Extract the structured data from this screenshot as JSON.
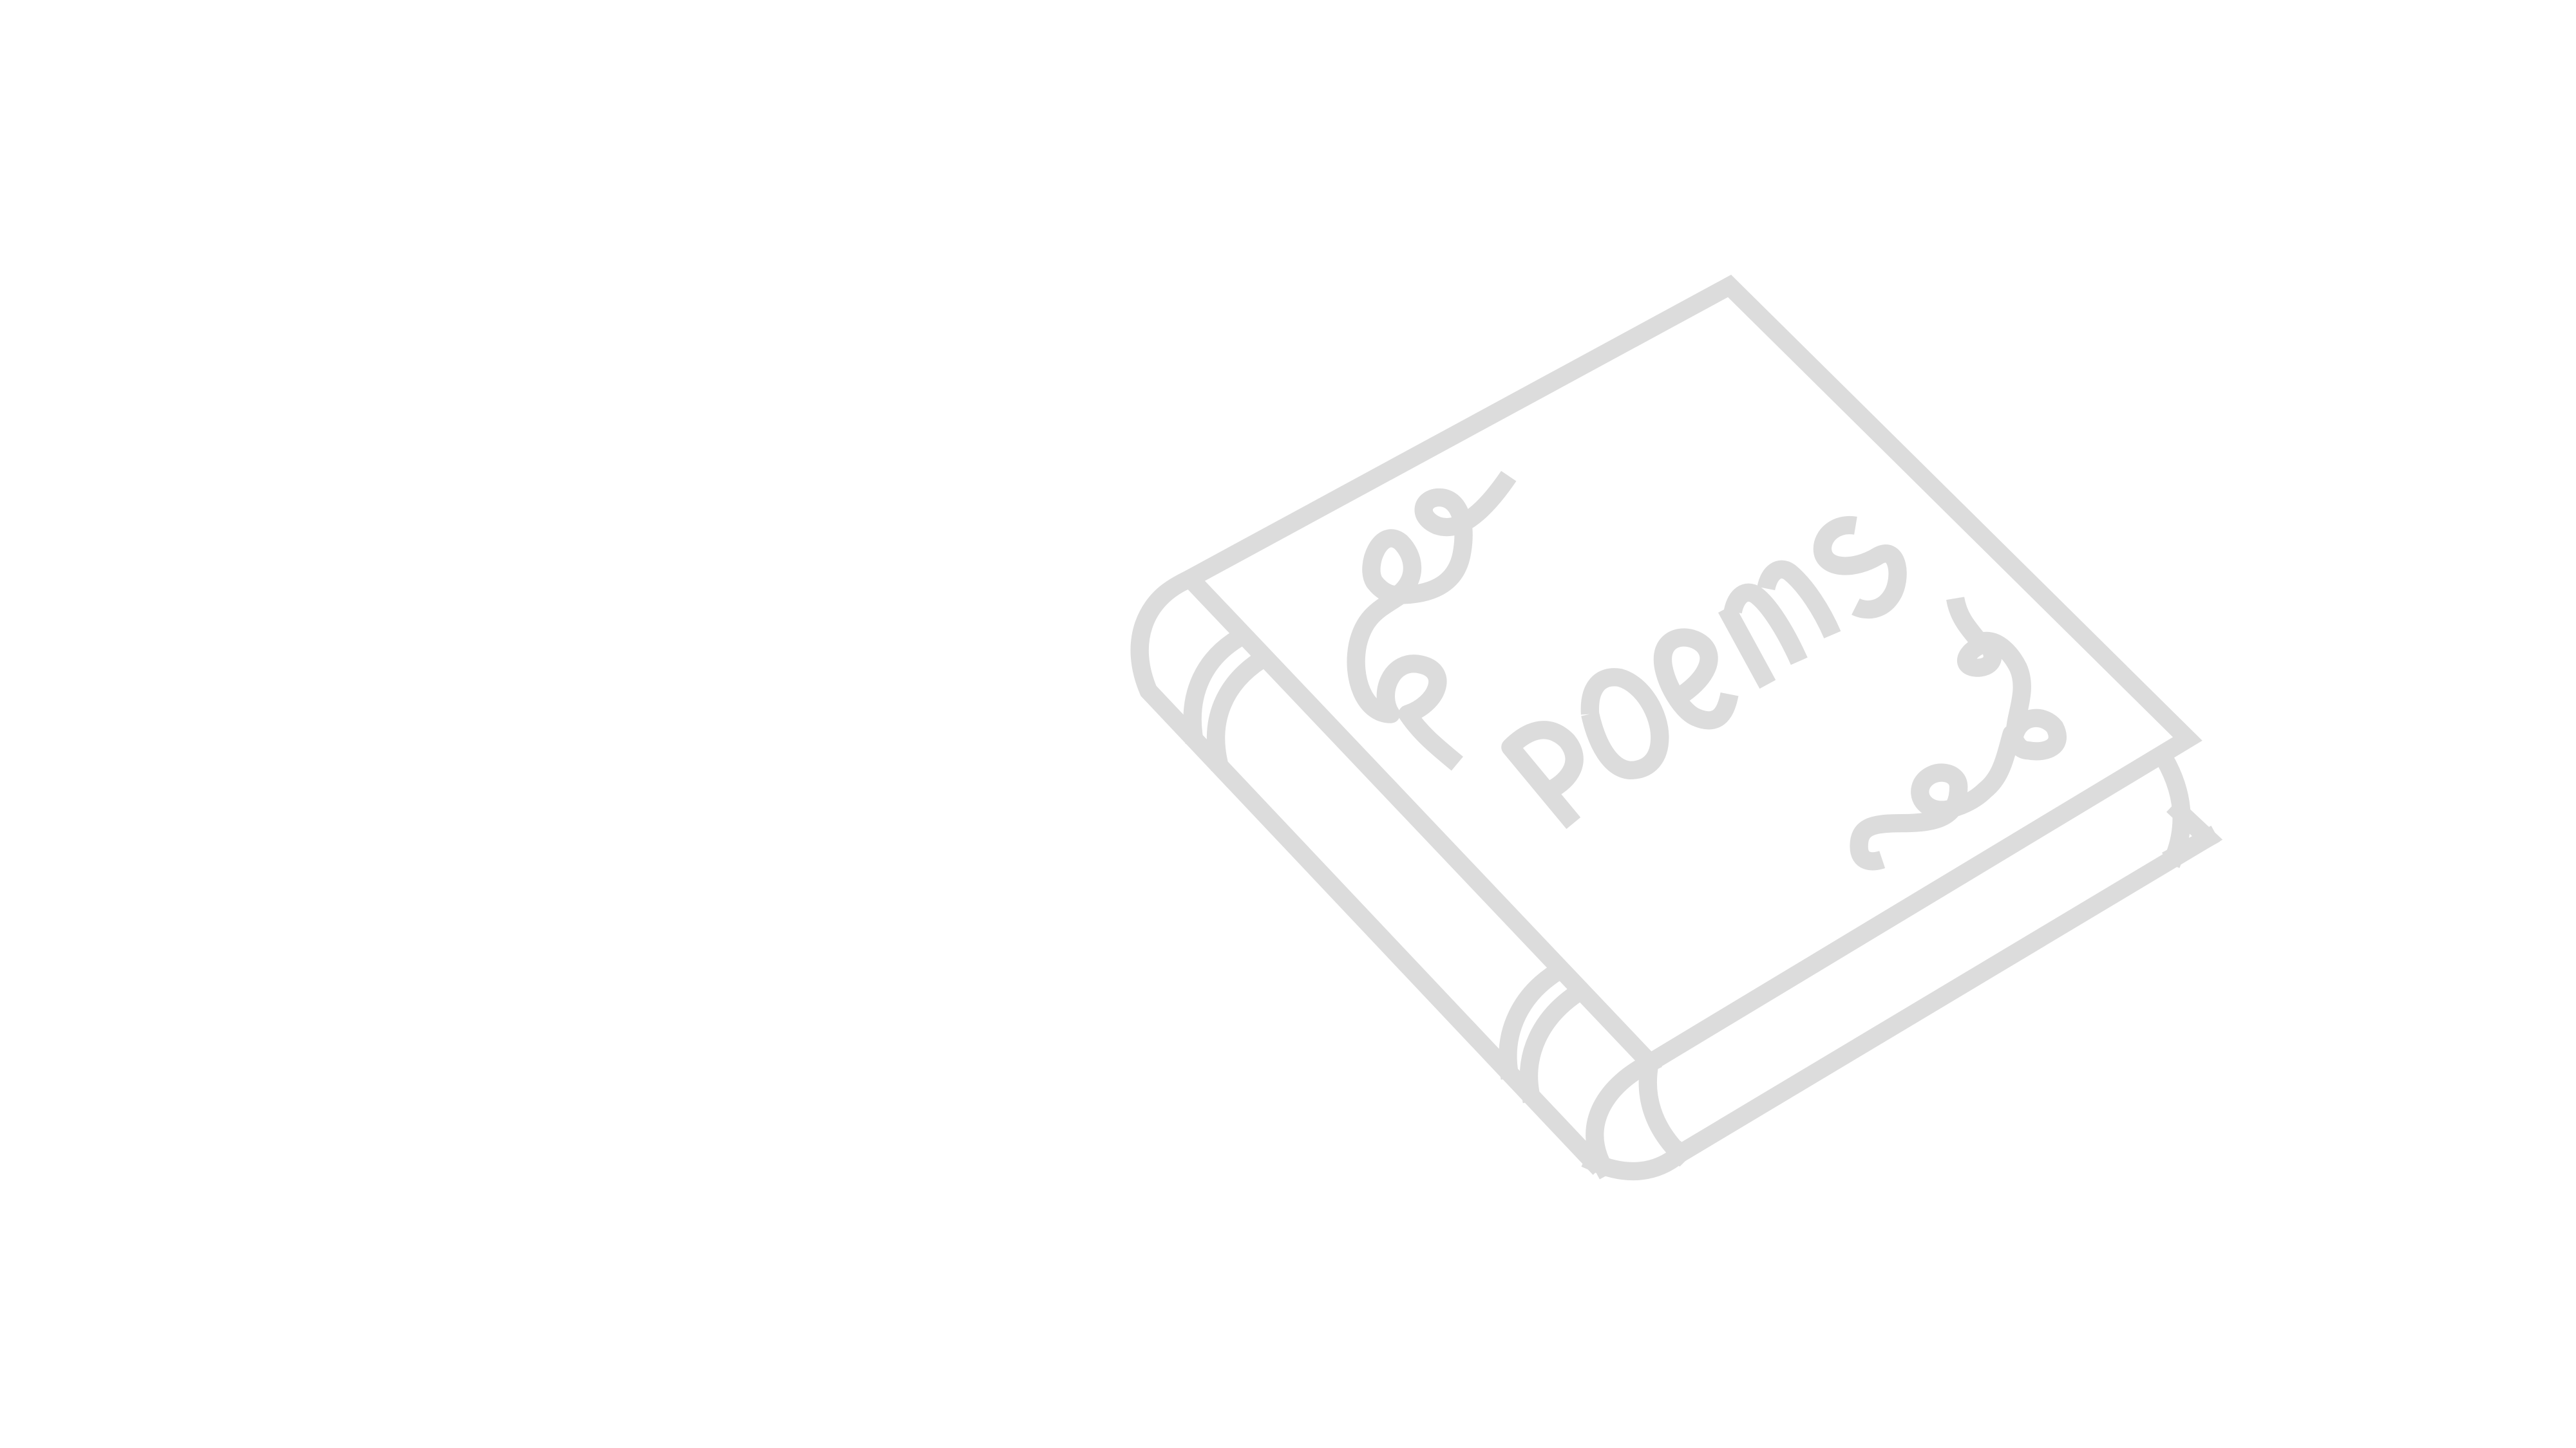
{
  "illustration": {
    "subject": "book",
    "cover_title": "poems",
    "colors": {
      "background": "#ffffff",
      "stroke": "#dcdcdc"
    }
  }
}
